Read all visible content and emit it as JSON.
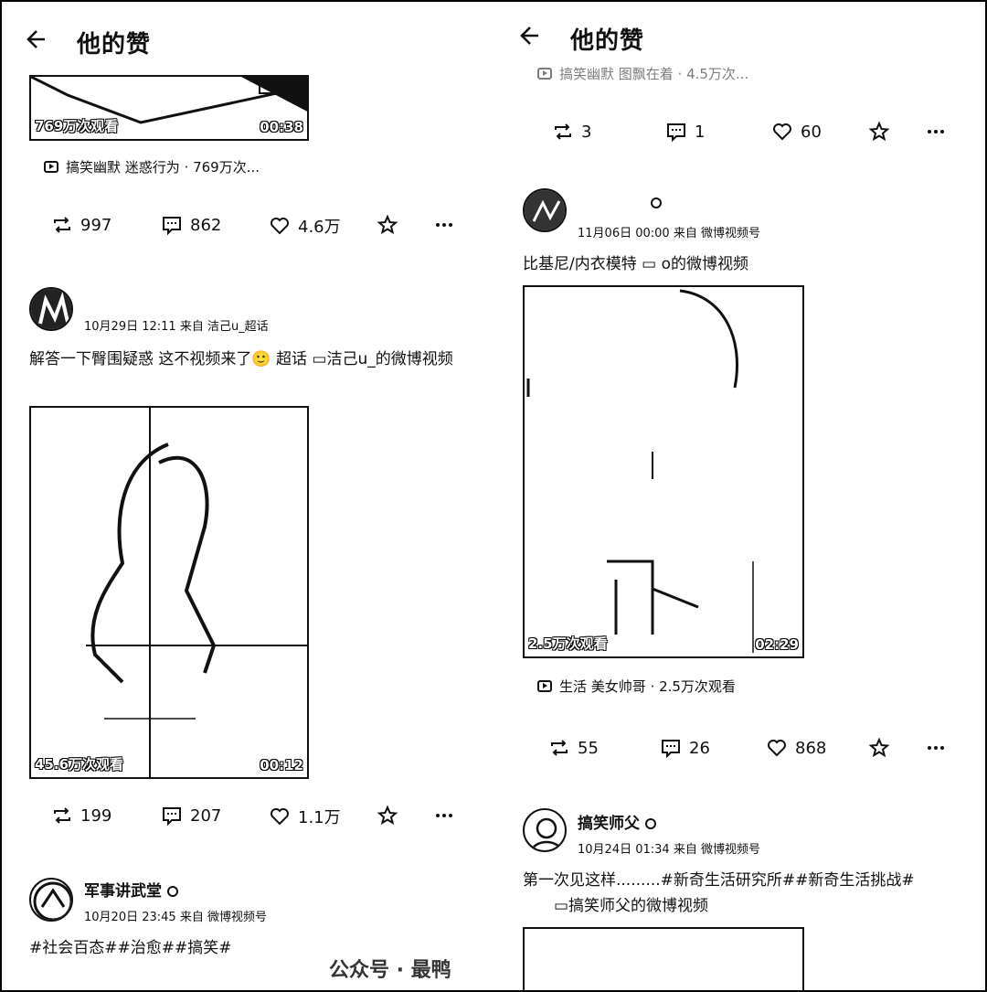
{
  "left": {
    "title": "他的赞",
    "post1": {
      "views_badge": "769万次观看",
      "duration": "00:38",
      "source": "搞笑幽默 迷惑行为 · 769万次...",
      "reposts": "997",
      "comments": "862",
      "likes": "4.6万"
    },
    "post2": {
      "meta": "10月29日 12:11  来自 洁己u_超话",
      "text": "解答一下臀围疑惑 这不视频来了🙂   超话 ▭洁己u_的微博视频",
      "views_badge": "45.6万次观看",
      "duration": "00:12",
      "reposts": "199",
      "comments": "207",
      "likes": "1.1万"
    },
    "post3": {
      "name": "军事讲武堂",
      "meta": "10月20日 23:45  来自 微博视频号",
      "text": "#社会百态##治愈##搞笑#"
    }
  },
  "right": {
    "title": "他的赞",
    "post0": {
      "source": "搞笑幽默 图飘在着 · 4.5万次...",
      "reposts": "3",
      "comments": "1",
      "likes": "60"
    },
    "post1": {
      "meta": "11月06日 00:00  来自 微博视频号",
      "text": "比基尼/内衣模特 ▭     o的微博视频",
      "views_badge": "2.5万次观看",
      "duration": "02:29",
      "source": "生活 美女帅哥 · 2.5万次观看",
      "reposts": "55",
      "comments": "26",
      "likes": "868"
    },
    "post2": {
      "name": "搞笑师父",
      "meta": "10月24日 01:34  来自 微博视频号",
      "text1": "第一次见这样.........#新奇生活研究所##新奇生活挑战#",
      "text2": "▭搞笑师父的微博视频"
    }
  },
  "watermark": "公众号 · 最鸭"
}
